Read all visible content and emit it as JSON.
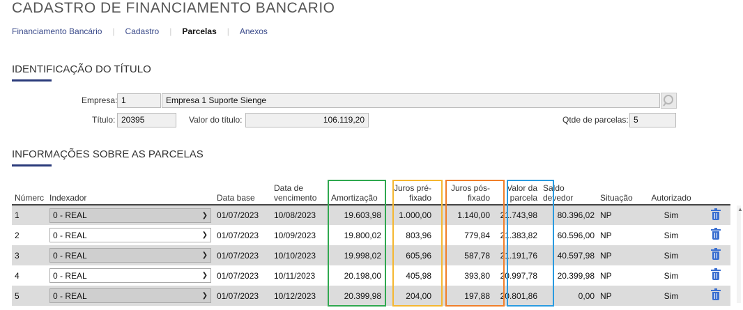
{
  "page": {
    "title": "CADASTRO DE FINANCIAMENTO BANCARIO"
  },
  "tabs": [
    {
      "label": "Financiamento Bancário",
      "active": false
    },
    {
      "label": "Cadastro",
      "active": false
    },
    {
      "label": "Parcelas",
      "active": true
    },
    {
      "label": "Anexos",
      "active": false
    }
  ],
  "identificacao": {
    "title": "IDENTIFICAÇÃO DO TÍTULO",
    "empresa_label": "Empresa:",
    "empresa_code": "1",
    "empresa_name": "Empresa 1 Suporte Sienge",
    "titulo_label": "Título:",
    "titulo_value": "20395",
    "valor_label": "Valor do título:",
    "valor_value": "106.119,20",
    "qtde_label": "Qtde de parcelas:",
    "qtde_value": "5"
  },
  "parcelas": {
    "title": "INFORMAÇÕES SOBRE AS PARCELAS",
    "headers": {
      "numero": "Númerc",
      "indexador": "Indexador",
      "data_base": "Data base",
      "data_venc": "Data de vencimento",
      "amortizacao": "Amortização",
      "juros_pre": "Juros pré-fixado",
      "juros_pos": "Juros pós-fixado",
      "valor_parcela": "Valor da parcela",
      "saldo": "Saldo devedor",
      "situacao": "Situação",
      "autorizado": "Autorizado"
    },
    "rows": [
      {
        "num": "1",
        "indexador": "0 - REAL",
        "data_base": "01/07/2023",
        "data_venc": "10/08/2023",
        "amortizacao": "19.603,98",
        "juros_pre": "1.000,00",
        "juros_pos": "1.140,00",
        "valor_parcela": "21.743,98",
        "saldo": "80.396,02",
        "situacao": "NP",
        "autorizado": "Sim"
      },
      {
        "num": "2",
        "indexador": "0 - REAL",
        "data_base": "01/07/2023",
        "data_venc": "10/09/2023",
        "amortizacao": "19.800,02",
        "juros_pre": "803,96",
        "juros_pos": "779,84",
        "valor_parcela": "21.383,82",
        "saldo": "60.596,00",
        "situacao": "NP",
        "autorizado": "Sim"
      },
      {
        "num": "3",
        "indexador": "0 - REAL",
        "data_base": "01/07/2023",
        "data_venc": "10/10/2023",
        "amortizacao": "19.998,02",
        "juros_pre": "605,96",
        "juros_pos": "587,78",
        "valor_parcela": "21.191,76",
        "saldo": "40.597,98",
        "situacao": "NP",
        "autorizado": "Sim"
      },
      {
        "num": "4",
        "indexador": "0 - REAL",
        "data_base": "01/07/2023",
        "data_venc": "10/11/2023",
        "amortizacao": "20.198,00",
        "juros_pre": "405,98",
        "juros_pos": "393,80",
        "valor_parcela": "20.997,78",
        "saldo": "20.399,98",
        "situacao": "NP",
        "autorizado": "Sim"
      },
      {
        "num": "5",
        "indexador": "0 - REAL",
        "data_base": "01/07/2023",
        "data_venc": "10/12/2023",
        "amortizacao": "20.399,98",
        "juros_pre": "204,00",
        "juros_pos": "197,88",
        "valor_parcela": "20.801,86",
        "saldo": "0,00",
        "situacao": "NP",
        "autorizado": "Sim"
      }
    ]
  },
  "icons": {
    "lookup": "search-icon",
    "delete": "trash-icon",
    "dropdown": "chevron-down-icon"
  },
  "colors": {
    "highlight_amortizacao": "#2fa84f",
    "highlight_juros_pre": "#f5b731",
    "highlight_juros_pos": "#f07f2a",
    "highlight_valor_parcela": "#2a9be0",
    "trash": "#3a6fd0",
    "accent": "#2a3a7a"
  }
}
